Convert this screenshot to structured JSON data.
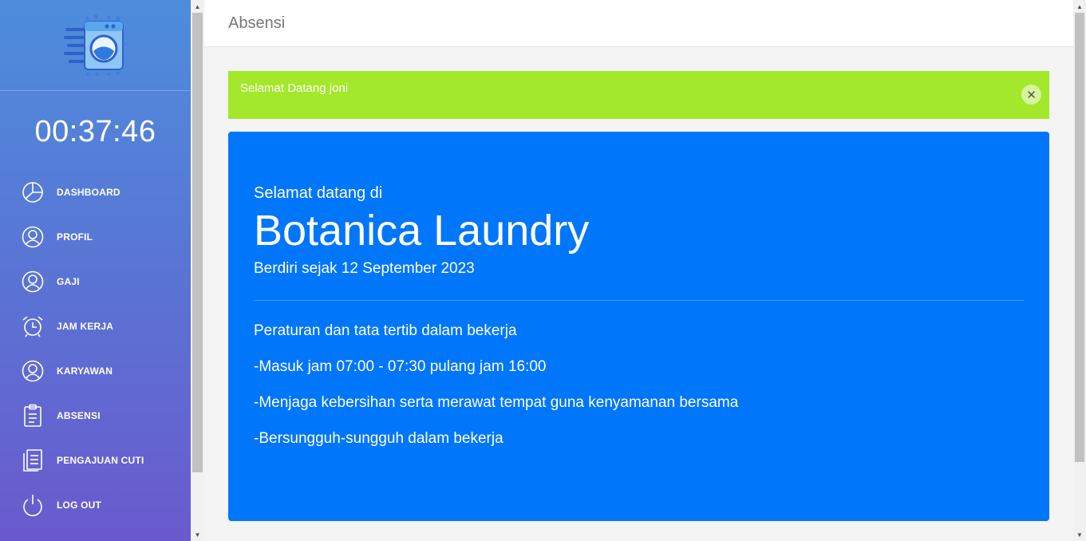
{
  "sidebar": {
    "logo_icon": "washing-machine-icon",
    "clock": "00:37:46",
    "items": [
      {
        "label": "DASHBOARD",
        "icon": "dashboard-pie-icon"
      },
      {
        "label": "PROFIL",
        "icon": "user-icon"
      },
      {
        "label": "GAJI",
        "icon": "user-icon"
      },
      {
        "label": "JAM KERJA",
        "icon": "alarm-clock-icon"
      },
      {
        "label": "KARYAWAN",
        "icon": "user-icon"
      },
      {
        "label": "ABSENSI",
        "icon": "clipboard-icon"
      },
      {
        "label": "PENGAJUAN CUTI",
        "icon": "document-icon"
      },
      {
        "label": "LOG OUT",
        "icon": "power-icon"
      }
    ]
  },
  "header": {
    "title": "Absensi"
  },
  "alert": {
    "message": "Selamat Datang joni",
    "close_label": "✕",
    "color": "#a3e82a"
  },
  "welcome": {
    "pre": "Selamat datang di",
    "brand": "Botanica Laundry",
    "since": "Berdiri sejak 12 September 2023",
    "rules": [
      "Peraturan dan tata tertib dalam bekerja",
      "-Masuk jam 07:00 - 07:30 pulang jam 16:00",
      "-Menjaga kebersihan serta merawat tempat guna kenyamanan bersama",
      "-Bersungguh-sungguh dalam bekerja"
    ],
    "color": "#0076fb"
  },
  "scrollbar": {
    "up": "▲",
    "down": "▼"
  }
}
